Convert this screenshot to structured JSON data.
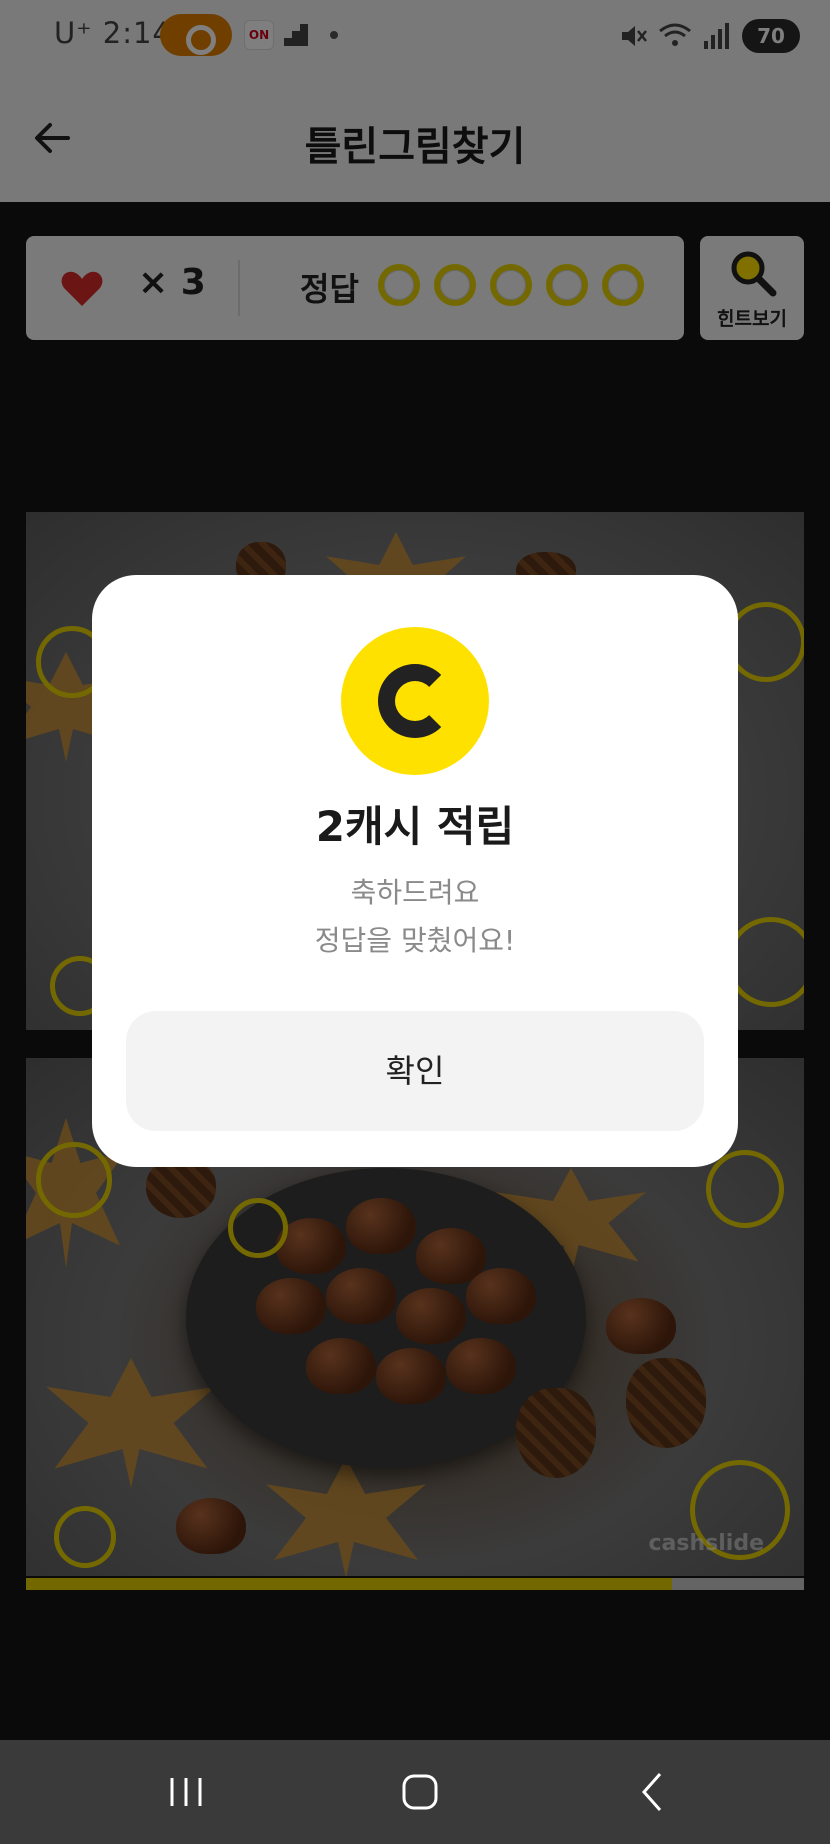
{
  "status_bar": {
    "carrier_time": "U⁺ 2:14",
    "notification_label": "ON",
    "battery": "70"
  },
  "header": {
    "title": "틀린그림찾기"
  },
  "score": {
    "lives_text": "× 3",
    "answers_label": "정답",
    "answer_slots_total": 5
  },
  "hint": {
    "label": "힌트보기"
  },
  "puzzle": {
    "watermark": "cashslide",
    "progress": 0.83
  },
  "modal": {
    "title": "2캐시 적립",
    "message_line1": "축하드려요",
    "message_line2": "정답을 맞췄어요!",
    "confirm_label": "확인"
  },
  "colors": {
    "accent_yellow": "#ffe100",
    "marker_yellow": "#e8d200",
    "heart_red": "#d62b2b"
  },
  "icons": {
    "back": "arrow-left-icon",
    "heart": "heart-icon",
    "hint": "magnifier-icon",
    "coin": "cash-coin-icon"
  }
}
